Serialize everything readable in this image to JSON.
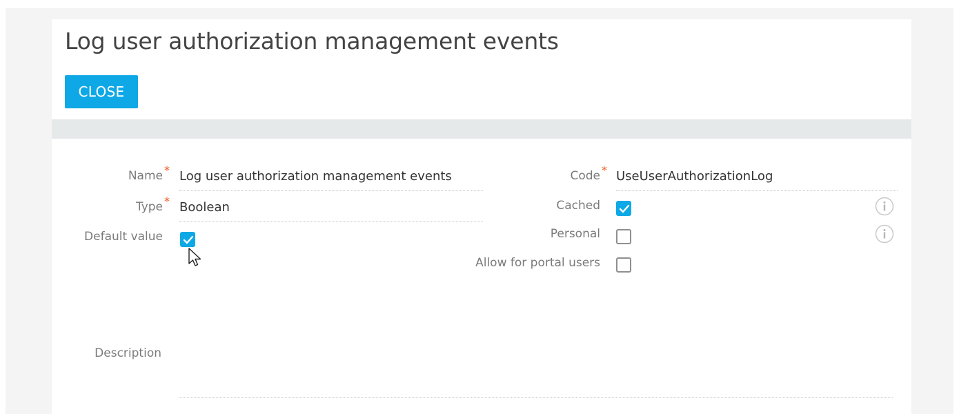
{
  "page": {
    "title": "Log user authorization management events"
  },
  "toolbar": {
    "close_label": "CLOSE"
  },
  "form": {
    "name": {
      "label": "Name",
      "required_mark": "*",
      "value": "Log user authorization management events"
    },
    "type": {
      "label": "Type",
      "required_mark": "*",
      "value": "Boolean"
    },
    "default_value": {
      "label": "Default value",
      "checked": true
    },
    "code": {
      "label": "Code",
      "required_mark": "*",
      "value": "UseUserAuthorizationLog"
    },
    "cached": {
      "label": "Cached",
      "checked": true
    },
    "personal": {
      "label": "Personal",
      "checked": false
    },
    "allow_portal": {
      "label": "Allow for portal users",
      "checked": false
    },
    "description": {
      "label": "Description",
      "value": ""
    }
  },
  "icons": {
    "cached_info": "info-icon",
    "personal_info": "info-icon",
    "checkmark": "check-icon",
    "cursor": "mouse-pointer-icon"
  },
  "colors": {
    "accent": "#0fa8e6",
    "required": "#f15a24"
  }
}
